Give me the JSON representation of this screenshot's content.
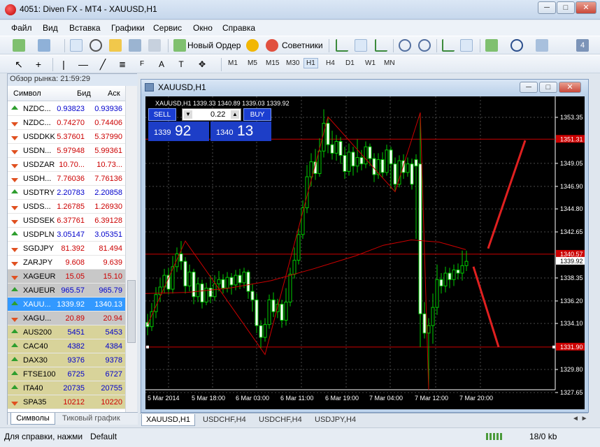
{
  "window": {
    "title": "4051: Diven FX - MT4 - XAUUSD,H1",
    "min": "─",
    "max": "□",
    "close": "✕"
  },
  "menu": [
    "Файл",
    "Вид",
    "Вставка",
    "Графики",
    "Сервис",
    "Окно",
    "Справка"
  ],
  "toolbar": {
    "new_order": "Новый Ордер",
    "advisors": "Советники",
    "badge": "4"
  },
  "timeframes": [
    "M1",
    "M5",
    "M15",
    "M30",
    "H1",
    "H4",
    "D1",
    "W1",
    "MN"
  ],
  "active_timeframe": "H1",
  "market_watch": {
    "header": "Обзор рынка: 21:59:29",
    "columns": [
      "Символ",
      "Бид",
      "Аск"
    ],
    "rows": [
      {
        "symbol": "NZDC...",
        "bid": "0.93823",
        "ask": "0.93936",
        "dir": "up",
        "color": "#0000cc",
        "bg": ""
      },
      {
        "symbol": "NZDC...",
        "bid": "0.74270",
        "ask": "0.74406",
        "dir": "down",
        "color": "#cc0000",
        "bg": ""
      },
      {
        "symbol": "USDDKK",
        "bid": "5.37601",
        "ask": "5.37990",
        "dir": "down",
        "color": "#cc0000",
        "bg": ""
      },
      {
        "symbol": "USDN...",
        "bid": "5.97948",
        "ask": "5.99361",
        "dir": "down",
        "color": "#cc0000",
        "bg": ""
      },
      {
        "symbol": "USDZAR",
        "bid": "10.70...",
        "ask": "10.73...",
        "dir": "down",
        "color": "#cc0000",
        "bg": ""
      },
      {
        "symbol": "USDH...",
        "bid": "7.76036",
        "ask": "7.76136",
        "dir": "down",
        "color": "#cc0000",
        "bg": ""
      },
      {
        "symbol": "USDTRY",
        "bid": "2.20783",
        "ask": "2.20858",
        "dir": "up",
        "color": "#0000cc",
        "bg": ""
      },
      {
        "symbol": "USDS...",
        "bid": "1.26785",
        "ask": "1.26930",
        "dir": "down",
        "color": "#cc0000",
        "bg": ""
      },
      {
        "symbol": "USDSEK",
        "bid": "6.37761",
        "ask": "6.39128",
        "dir": "down",
        "color": "#cc0000",
        "bg": ""
      },
      {
        "symbol": "USDPLN",
        "bid": "3.05147",
        "ask": "3.05351",
        "dir": "up",
        "color": "#0000cc",
        "bg": ""
      },
      {
        "symbol": "SGDJPY",
        "bid": "81.392",
        "ask": "81.494",
        "dir": "down",
        "color": "#cc0000",
        "bg": ""
      },
      {
        "symbol": "ZARJPY",
        "bid": "9.608",
        "ask": "9.639",
        "dir": "down",
        "color": "#cc0000",
        "bg": ""
      },
      {
        "symbol": "XAGEUR",
        "bid": "15.05",
        "ask": "15.10",
        "dir": "down",
        "color": "#cc0000",
        "bg": "#c8c8c8"
      },
      {
        "symbol": "XAUEUR",
        "bid": "965.57",
        "ask": "965.79",
        "dir": "up",
        "color": "#0000cc",
        "bg": "#c8c8c8"
      },
      {
        "symbol": "XAUU...",
        "bid": "1339.92",
        "ask": "1340.13",
        "dir": "up",
        "color": "#ffffff",
        "bg": "#3399ff"
      },
      {
        "symbol": "XAGU...",
        "bid": "20.89",
        "ask": "20.94",
        "dir": "down",
        "color": "#cc0000",
        "bg": "#c8c8c8"
      },
      {
        "symbol": "AUS200",
        "bid": "5451",
        "ask": "5453",
        "dir": "up",
        "color": "#0000cc",
        "bg": "#d8d39a"
      },
      {
        "symbol": "CAC40",
        "bid": "4382",
        "ask": "4384",
        "dir": "up",
        "color": "#0000cc",
        "bg": "#d8d39a"
      },
      {
        "symbol": "DAX30",
        "bid": "9376",
        "ask": "9378",
        "dir": "up",
        "color": "#0000cc",
        "bg": "#d8d39a"
      },
      {
        "symbol": "FTSE100",
        "bid": "6725",
        "ask": "6727",
        "dir": "up",
        "color": "#0000cc",
        "bg": "#d8d39a"
      },
      {
        "symbol": "ITA40",
        "bid": "20735",
        "ask": "20755",
        "dir": "up",
        "color": "#0000cc",
        "bg": "#d8d39a"
      },
      {
        "symbol": "SPA35",
        "bid": "10212",
        "ask": "10220",
        "dir": "down",
        "color": "#cc0000",
        "bg": "#d8d39a"
      }
    ],
    "tabs": [
      "Символы",
      "Тиковый график"
    ]
  },
  "chart_window": {
    "title": "XAUUSD,H1"
  },
  "chart": {
    "info": "XAUUSD,H1  1339.33 1340.89 1339.03 1339.92",
    "sell_label": "SELL",
    "buy_label": "BUY",
    "lot": "0.22",
    "sell_small": "1339",
    "sell_big": "92",
    "buy_small": "1340",
    "buy_big": "13",
    "price_labels": [
      "1353.35",
      "1349.05",
      "1346.90",
      "1344.80",
      "1342.65",
      "1338.35",
      "1336.20",
      "1334.10",
      "1329.80",
      "1327.65"
    ],
    "highlight_labels": [
      {
        "text": "1351.31",
        "bg": "#cc0000"
      },
      {
        "text": "1340.57",
        "bg": "#cc0000"
      },
      {
        "text": "1339.92",
        "bg": "#ffffff"
      },
      {
        "text": "1331.90",
        "bg": "#cc0000"
      }
    ],
    "time_labels": [
      "5 Mar 2014",
      "5 Mar 18:00",
      "6 Mar 03:00",
      "6 Mar 11:00",
      "6 Mar 19:00",
      "7 Mar 04:00",
      "7 Mar 12:00",
      "7 Mar 20:00"
    ]
  },
  "chart_tabs": [
    "XAUUSD,H1",
    "USDCHF,H4",
    "USDCHF,H4",
    "USDJPY,H4"
  ],
  "status": {
    "help": "Для справки, нажми",
    "profile": "Default",
    "traffic": "18/0 kb"
  }
}
